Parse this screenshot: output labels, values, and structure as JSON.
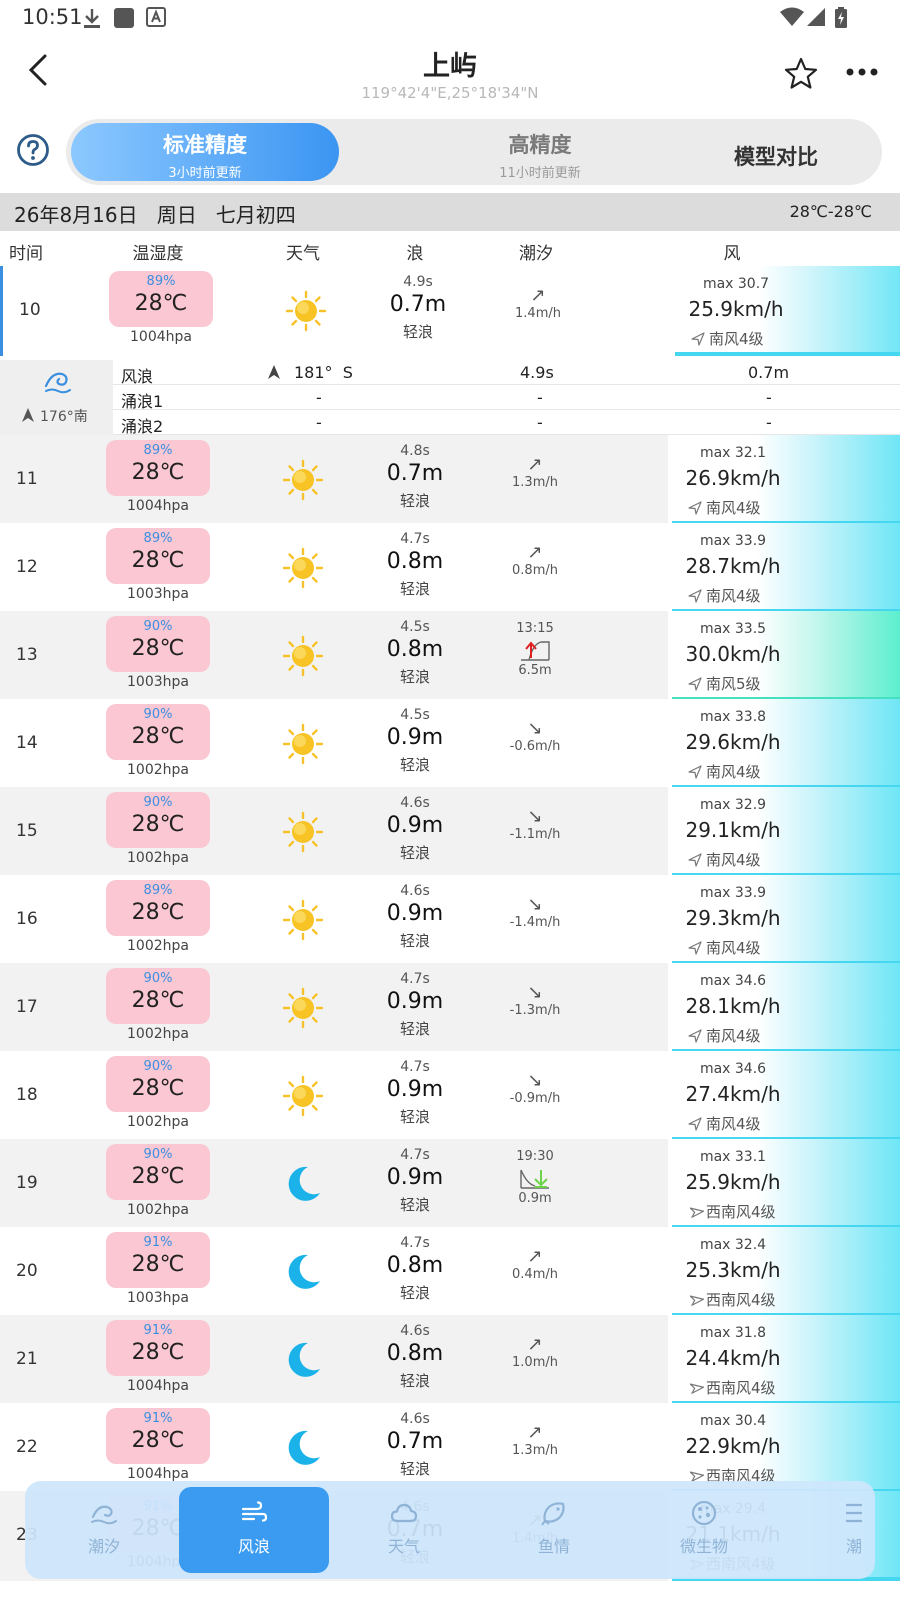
{
  "status_bar": {
    "time": "10:51"
  },
  "header": {
    "title": "上屿",
    "coords": "119°42'4\"E,25°18'34\"N"
  },
  "precision_tabs": [
    {
      "label": "标准精度",
      "sub": "3小时前更新",
      "active": true
    },
    {
      "label": "高精度",
      "sub": "11小时前更新",
      "active": false
    },
    {
      "label": "模型对比",
      "sub": "",
      "active": false
    }
  ],
  "date_bar": {
    "date": "26年8月16日   周日   七月初四",
    "temp_range": "28℃-28℃"
  },
  "columns": [
    "时间",
    "温湿度",
    "天气",
    "浪",
    "潮汐",
    "风"
  ],
  "detail": {
    "direction": "176°南",
    "lines": [
      {
        "name": "风浪",
        "dir": "181°  S",
        "period": "4.9s",
        "height": "0.7m"
      },
      {
        "name": "涌浪1",
        "dir": "-",
        "period": "-",
        "height": "-"
      },
      {
        "name": "涌浪2",
        "dir": "-",
        "period": "-",
        "height": "-"
      }
    ]
  },
  "rows": [
    {
      "hour": "10",
      "humidity": "89%",
      "temp": "28℃",
      "pressure": "1004hpa",
      "weather": "sun-icon",
      "period": "4.9s",
      "wave": "0.7m",
      "wave_level": "轻浪",
      "tide_arrow": "↗",
      "tide_rate": "1.4m/h",
      "wind_max": "max 30.7",
      "wind_speed": "25.9km/h",
      "wind_level": "南风4级",
      "wind_rot": 0,
      "strong": false,
      "alt": false
    },
    {
      "hour": "11",
      "humidity": "89%",
      "temp": "28℃",
      "pressure": "1004hpa",
      "weather": "sun-icon",
      "period": "4.8s",
      "wave": "0.7m",
      "wave_level": "轻浪",
      "tide_arrow": "↗",
      "tide_rate": "1.3m/h",
      "wind_max": "max 32.1",
      "wind_speed": "26.9km/h",
      "wind_level": "南风4级",
      "wind_rot": 0,
      "strong": false,
      "alt": true
    },
    {
      "hour": "12",
      "humidity": "89%",
      "temp": "28℃",
      "pressure": "1003hpa",
      "weather": "sun-icon",
      "period": "4.7s",
      "wave": "0.8m",
      "wave_level": "轻浪",
      "tide_arrow": "↗",
      "tide_rate": "0.8m/h",
      "wind_max": "max 33.9",
      "wind_speed": "28.7km/h",
      "wind_level": "南风4级",
      "wind_rot": 0,
      "strong": false,
      "alt": false
    },
    {
      "hour": "13",
      "humidity": "90%",
      "temp": "28℃",
      "pressure": "1003hpa",
      "weather": "sun-icon",
      "period": "4.5s",
      "wave": "0.8m",
      "wave_level": "轻浪",
      "tide_event": "high",
      "tide_time": "13:15",
      "tide_value": "6.5m",
      "wind_max": "max 33.5",
      "wind_speed": "30.0km/h",
      "wind_level": "南风5级",
      "wind_rot": 0,
      "strong": true,
      "alt": true
    },
    {
      "hour": "14",
      "humidity": "90%",
      "temp": "28℃",
      "pressure": "1002hpa",
      "weather": "sun-icon",
      "period": "4.5s",
      "wave": "0.9m",
      "wave_level": "轻浪",
      "tide_arrow": "↘",
      "tide_rate": "-0.6m/h",
      "wind_max": "max 33.8",
      "wind_speed": "29.6km/h",
      "wind_level": "南风4级",
      "wind_rot": 0,
      "strong": false,
      "alt": false
    },
    {
      "hour": "15",
      "humidity": "90%",
      "temp": "28℃",
      "pressure": "1002hpa",
      "weather": "sun-icon",
      "period": "4.6s",
      "wave": "0.9m",
      "wave_level": "轻浪",
      "tide_arrow": "↘",
      "tide_rate": "-1.1m/h",
      "wind_max": "max 32.9",
      "wind_speed": "29.1km/h",
      "wind_level": "南风4级",
      "wind_rot": 0,
      "strong": false,
      "alt": true
    },
    {
      "hour": "16",
      "humidity": "89%",
      "temp": "28℃",
      "pressure": "1002hpa",
      "weather": "sun-icon",
      "period": "4.6s",
      "wave": "0.9m",
      "wave_level": "轻浪",
      "tide_arrow": "↘",
      "tide_rate": "-1.4m/h",
      "wind_max": "max 33.9",
      "wind_speed": "29.3km/h",
      "wind_level": "南风4级",
      "wind_rot": 0,
      "strong": false,
      "alt": false
    },
    {
      "hour": "17",
      "humidity": "90%",
      "temp": "28℃",
      "pressure": "1002hpa",
      "weather": "sun-icon",
      "period": "4.7s",
      "wave": "0.9m",
      "wave_level": "轻浪",
      "tide_arrow": "↘",
      "tide_rate": "-1.3m/h",
      "wind_max": "max 34.6",
      "wind_speed": "28.1km/h",
      "wind_level": "南风4级",
      "wind_rot": 0,
      "strong": false,
      "alt": true
    },
    {
      "hour": "18",
      "humidity": "90%",
      "temp": "28℃",
      "pressure": "1002hpa",
      "weather": "sun-icon",
      "period": "4.7s",
      "wave": "0.9m",
      "wave_level": "轻浪",
      "tide_arrow": "↘",
      "tide_rate": "-0.9m/h",
      "wind_max": "max 34.6",
      "wind_speed": "27.4km/h",
      "wind_level": "南风4级",
      "wind_rot": 0,
      "strong": false,
      "alt": false
    },
    {
      "hour": "19",
      "humidity": "90%",
      "temp": "28℃",
      "pressure": "1002hpa",
      "weather": "moon-icon",
      "period": "4.7s",
      "wave": "0.9m",
      "wave_level": "轻浪",
      "tide_event": "low",
      "tide_time": "19:30",
      "tide_value": "0.9m",
      "wind_max": "max 33.1",
      "wind_speed": "25.9km/h",
      "wind_level": "西南风4级",
      "wind_rot": 40,
      "strong": false,
      "alt": true
    },
    {
      "hour": "20",
      "humidity": "91%",
      "temp": "28℃",
      "pressure": "1003hpa",
      "weather": "moon-icon",
      "period": "4.7s",
      "wave": "0.8m",
      "wave_level": "轻浪",
      "tide_arrow": "↗",
      "tide_rate": "0.4m/h",
      "wind_max": "max 32.4",
      "wind_speed": "25.3km/h",
      "wind_level": "西南风4级",
      "wind_rot": 40,
      "strong": false,
      "alt": false
    },
    {
      "hour": "21",
      "humidity": "91%",
      "temp": "28℃",
      "pressure": "1004hpa",
      "weather": "moon-icon",
      "period": "4.6s",
      "wave": "0.8m",
      "wave_level": "轻浪",
      "tide_arrow": "↗",
      "tide_rate": "1.0m/h",
      "wind_max": "max 31.8",
      "wind_speed": "24.4km/h",
      "wind_level": "西南风4级",
      "wind_rot": 40,
      "strong": false,
      "alt": true
    },
    {
      "hour": "22",
      "humidity": "91%",
      "temp": "28℃",
      "pressure": "1004hpa",
      "weather": "moon-icon",
      "period": "4.6s",
      "wave": "0.7m",
      "wave_level": "轻浪",
      "tide_arrow": "↗",
      "tide_rate": "1.3m/h",
      "wind_max": "max 30.4",
      "wind_speed": "22.9km/h",
      "wind_level": "西南风4级",
      "wind_rot": 40,
      "strong": false,
      "alt": false
    },
    {
      "hour": "23",
      "humidity": "91%",
      "temp": "28℃",
      "pressure": "1004hpa",
      "weather": "moon-icon",
      "period": "4.6s",
      "wave": "0.7m",
      "wave_level": "轻浪",
      "tide_arrow": "↗",
      "tide_rate": "1.4m/h",
      "wind_max": "max 29.4",
      "wind_speed": "21.1km/h",
      "wind_level": "西南风4级",
      "wind_rot": 40,
      "strong": false,
      "alt": true
    }
  ],
  "bottom_nav": [
    {
      "label": "潮汐",
      "icon": "tide-icon",
      "active": false
    },
    {
      "label": "风浪",
      "icon": "wind-icon",
      "active": true
    },
    {
      "label": "天气",
      "icon": "cloud-icon",
      "active": false
    },
    {
      "label": "鱼情",
      "icon": "fish-icon",
      "active": false
    },
    {
      "label": "微生物",
      "icon": "microbe-icon",
      "active": false
    },
    {
      "label": "潮",
      "icon": "menu-icon",
      "active": false
    }
  ],
  "colors": {
    "accent": "#3a9bf0",
    "temp_card": "#fbc7d2",
    "humidity": "#3b8fe0",
    "wind_gradient": "#6fe6f6",
    "wind_strong": "#5cefcf"
  }
}
